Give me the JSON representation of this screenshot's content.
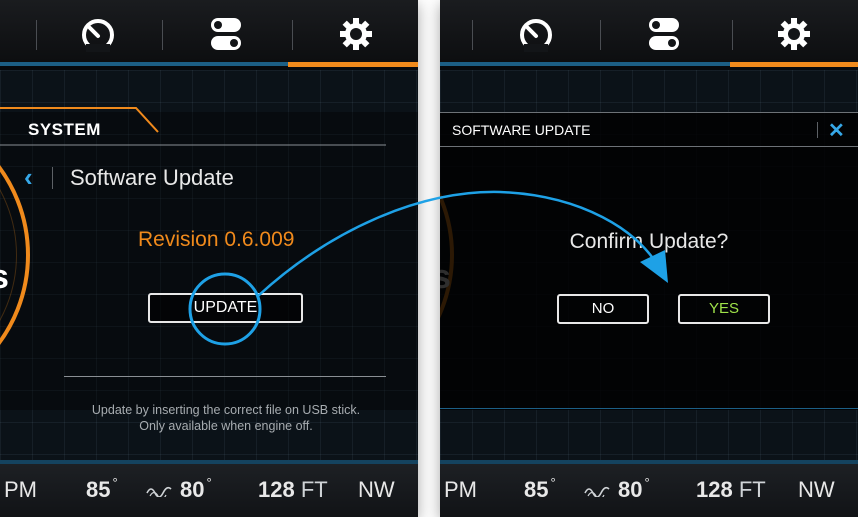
{
  "colors": {
    "accent_blue": "#36a8e8",
    "accent_orange": "#f08a1c",
    "yes_green": "#9fe34a",
    "background": "#06090d"
  },
  "nav": {
    "items": [
      {
        "icon": "speedometer-icon"
      },
      {
        "icon": "toggle-switches-icon"
      },
      {
        "icon": "gear-icon",
        "active": true
      }
    ]
  },
  "left_screen": {
    "gauge_char": "s",
    "tab_label": "SYSTEM",
    "page_title": "Software Update",
    "revision": "Revision 0.6.009",
    "update_button": "UPDATE",
    "help_line1": "Update by inserting the correct file on USB stick.",
    "help_line2": "Only available when engine off."
  },
  "right_screen": {
    "gauge_char": "s",
    "dialog_title": "SOFTWARE UPDATE",
    "confirm_text": "Confirm Update?",
    "no_button": "NO",
    "yes_button": "YES"
  },
  "status_bar": {
    "rpm_label": "PM",
    "temp1_value": "85",
    "temp1_unit": "°",
    "temp2_value": "80",
    "temp2_unit": "°",
    "depth_value": "128",
    "depth_unit": "FT",
    "heading": "NW"
  }
}
